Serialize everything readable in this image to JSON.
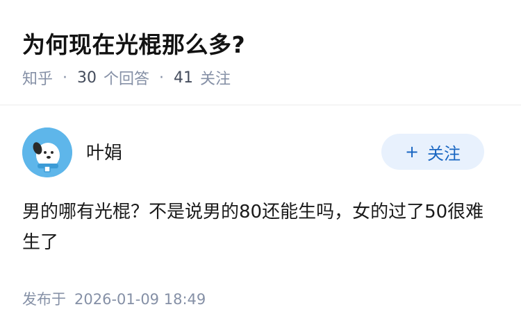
{
  "question": {
    "title": "为何现在光棍那么多?",
    "source": "知乎",
    "answer_count": "30",
    "answer_label": "个回答",
    "follower_count": "41",
    "follower_label": "关注"
  },
  "answer": {
    "author_name": "叶娟",
    "follow_label": "关注",
    "follow_icon": "plus-icon",
    "content": "男的哪有光棍？不是说男的80还能生吗，女的过了50很难生了",
    "publish_label": "发布于",
    "publish_time": "2026-01-09 18:49"
  },
  "colors": {
    "accent": "#1966c2",
    "follow_bg": "#e8f1fd",
    "meta_text": "#8590a6",
    "avatar_bg": "#5eb6ea"
  }
}
